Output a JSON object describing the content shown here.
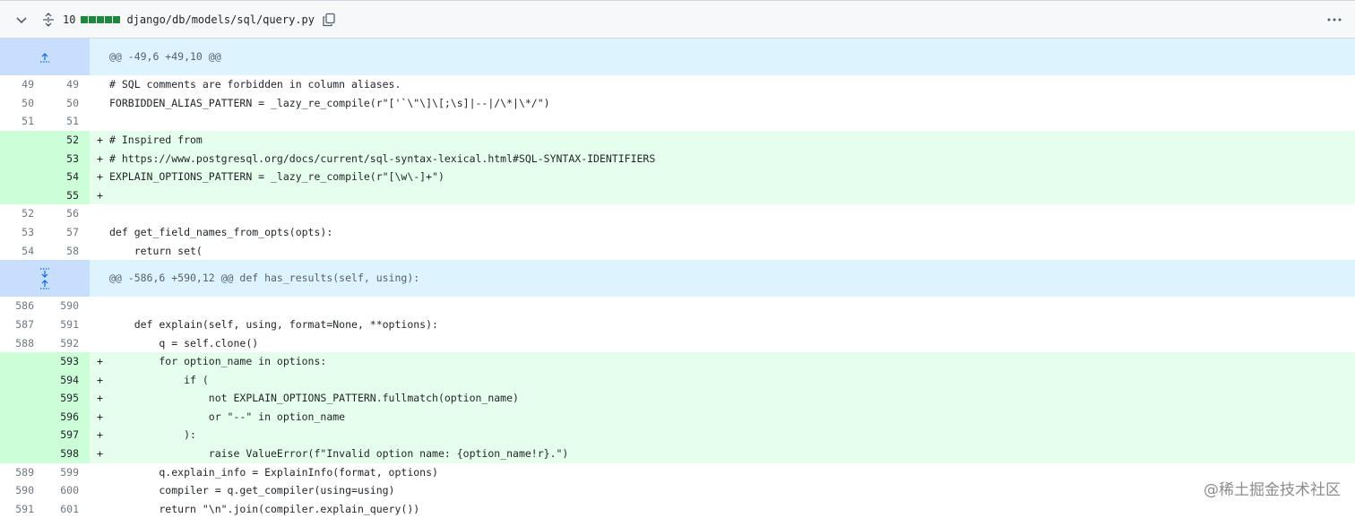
{
  "file": {
    "change_count": "10",
    "path": "django/db/models/sql/query.py"
  },
  "colors": {
    "added_bar": "#1f883d",
    "added_bg": "#e6ffec",
    "added_ln_bg": "#ccffd8",
    "hunk_bg": "#ddf4ff"
  },
  "hunks": [
    {
      "header": "@@ -49,6 +49,10 @@"
    },
    {
      "header": "@@ -586,6 +590,12 @@ def has_results(self, using):"
    }
  ],
  "lines": [
    {
      "type": "ctx",
      "old": "49",
      "new": "49",
      "code": "# SQL comments are forbidden in column aliases."
    },
    {
      "type": "ctx",
      "old": "50",
      "new": "50",
      "code": "FORBIDDEN_ALIAS_PATTERN = _lazy_re_compile(r\"['`\\\"\\]\\[;\\s]|--|/\\*|\\*/\")"
    },
    {
      "type": "ctx",
      "old": "51",
      "new": "51",
      "code": ""
    },
    {
      "type": "add",
      "old": "",
      "new": "52",
      "code": "# Inspired from"
    },
    {
      "type": "add",
      "old": "",
      "new": "53",
      "code": "# https://www.postgresql.org/docs/current/sql-syntax-lexical.html#SQL-SYNTAX-IDENTIFIERS"
    },
    {
      "type": "add",
      "old": "",
      "new": "54",
      "code": "EXPLAIN_OPTIONS_PATTERN = _lazy_re_compile(r\"[\\w\\-]+\")"
    },
    {
      "type": "add",
      "old": "",
      "new": "55",
      "code": ""
    },
    {
      "type": "ctx",
      "old": "52",
      "new": "56",
      "code": ""
    },
    {
      "type": "ctx",
      "old": "53",
      "new": "57",
      "code": "def get_field_names_from_opts(opts):"
    },
    {
      "type": "ctx",
      "old": "54",
      "new": "58",
      "code": "    return set("
    },
    {
      "type": "ctx",
      "old": "586",
      "new": "590",
      "code": ""
    },
    {
      "type": "ctx",
      "old": "587",
      "new": "591",
      "code": "    def explain(self, using, format=None, **options):"
    },
    {
      "type": "ctx",
      "old": "588",
      "new": "592",
      "code": "        q = self.clone()"
    },
    {
      "type": "add",
      "old": "",
      "new": "593",
      "code": "        for option_name in options:"
    },
    {
      "type": "add",
      "old": "",
      "new": "594",
      "code": "            if ("
    },
    {
      "type": "add",
      "old": "",
      "new": "595",
      "code": "                not EXPLAIN_OPTIONS_PATTERN.fullmatch(option_name)"
    },
    {
      "type": "add",
      "old": "",
      "new": "596",
      "code": "                or \"--\" in option_name"
    },
    {
      "type": "add",
      "old": "",
      "new": "597",
      "code": "            ):"
    },
    {
      "type": "add",
      "old": "",
      "new": "598",
      "code": "                raise ValueError(f\"Invalid option name: {option_name!r}.\")"
    },
    {
      "type": "ctx",
      "old": "589",
      "new": "599",
      "code": "        q.explain_info = ExplainInfo(format, options)"
    },
    {
      "type": "ctx",
      "old": "590",
      "new": "600",
      "code": "        compiler = q.get_compiler(using=using)"
    },
    {
      "type": "ctx",
      "old": "591",
      "new": "601",
      "code": "        return \"\\n\".join(compiler.explain_query())"
    }
  ],
  "watermark": "@稀土掘金技术社区"
}
